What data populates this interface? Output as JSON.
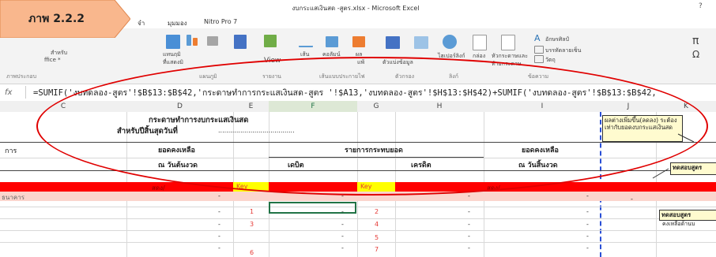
{
  "callout": {
    "label": "ภาพ 2.2.2"
  },
  "window": {
    "title": "งบกระแสเงินสด -สูตร.xlsx - Microsoft Excel",
    "help": "?"
  },
  "tabs": [
    "จำ",
    "มุมมอง",
    "Nitro Pro 7"
  ],
  "ribbon": {
    "buttons": [
      "สำหรับ",
      "ffice *",
      "แทนฤมิ",
      "ที่แสดงมิ",
      "View",
      "เส้น",
      "คอลัมน์",
      "ผล",
      "แพ้",
      "ตัวแบ่งข้อมูล",
      "ไฮเปอร์ลิงก์",
      "กล่อง",
      "หัวกระดาษและ",
      "ท้ายกระดาษ",
      "อักษรศิลป์",
      "บรรทัดลายเซ็น",
      "วัตถุ",
      "π",
      "Ω"
    ],
    "groups": [
      "ภาพประกอบ",
      "แผนภูมิ",
      "รายงาน",
      "เส้นแบบประกายไฟ",
      "ตัวกรอง",
      "ลิงก์",
      "ข้อความ"
    ]
  },
  "formula": {
    "fx": "fx",
    "text": "=SUMIF('งบทดลอง-สูตร'!$B$13:$B$42,'กระดาษทำการกระแสเงินสด-สูตร '!$A13,'งบทดลอง-สูตร'!$H$13:$H$42)+SUMIF('งบทดลอง-สูตร'!$B$13:$B$42,"
  },
  "columns": [
    "C",
    "D",
    "E",
    "F",
    "G",
    "H",
    "I",
    "J",
    "K"
  ],
  "sheet": {
    "title1": "กระดาษทำการงบกระแสเงินสด",
    "title2": "สำหรับปีสิ้นสุดวันที่",
    "title2_dots": "......................................",
    "col_item": "การ",
    "beg_balance_1": "ยอดคงเหลือ",
    "beg_balance_2": "ณ วันต้นงวด",
    "adjust_header": "รายการกระทบยอด",
    "debit": "เดบิต",
    "credit": "เครดิต",
    "end_balance_1": "ยอดคงเหลือ",
    "end_balance_2": "ณ วันสิ้นงวด",
    "red_row": {
      "a": "สดง/",
      "key1": "Key",
      "key2": "Key",
      "i": "สดง/"
    },
    "pink_row_label": "ธนาคาร",
    "dash": "-",
    "key_numbers_left": [
      "1",
      "3",
      "",
      "6"
    ],
    "key_numbers_right": [
      "2",
      "4",
      "5",
      "7"
    ]
  },
  "notes": {
    "note1": "ผลต่างเพิ่มขึ้น(ลดลง) ระต้องเท่ากับยอดงบกระแสเงินสด",
    "note2": "ทดสอบสูตร",
    "note3a": "ทดสอบสูตร",
    "note3b": "คงเหลือด้านบ"
  }
}
